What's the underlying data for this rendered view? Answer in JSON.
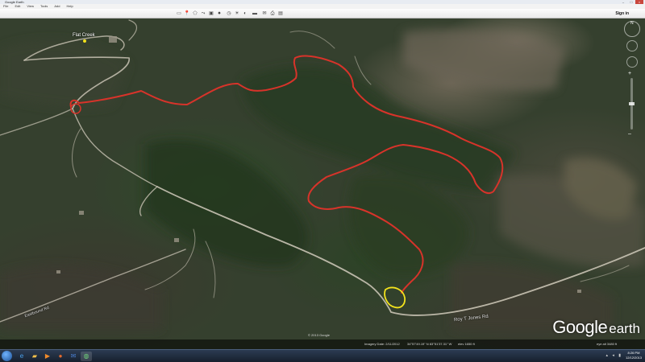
{
  "window": {
    "title": "Google Earth"
  },
  "menu": {
    "items": [
      "File",
      "Edit",
      "View",
      "Tools",
      "Add",
      "Help"
    ]
  },
  "toolbar": {
    "buttons": [
      "hide-sidebar-icon",
      "placemark-icon",
      "polygon-icon",
      "path-icon",
      "overlay-icon",
      "tour-icon",
      "history-icon",
      "sun-icon",
      "planets-icon",
      "ruler-icon",
      "email-icon",
      "print-icon",
      "maps-icon"
    ],
    "signin_label": "Sign in"
  },
  "map": {
    "place_label": "Flat Creek",
    "road_labels": {
      "roy_jones": "Roy T Jones Rd",
      "left_road": "Eastbound Rd"
    },
    "copyright": "© 2013 Google",
    "logo_google": "Google",
    "logo_earth": "earth",
    "path_color": "#d8332a",
    "highlight_color": "#f2e21d",
    "status": {
      "imagery_date": "Imagery Date: 2/11/2012",
      "coords": "34°57'49.19\" N    83°51'37.31\" W",
      "elev": "elev  1650 ft",
      "eye": "eye alt  3480 ft"
    }
  },
  "taskbar": {
    "time": "8:26 PM",
    "date": "12/12/2013",
    "apps": [
      "ie-icon",
      "explorer-icon",
      "media-icon",
      "firefox-icon",
      "outlook-icon",
      "earth-icon"
    ]
  }
}
